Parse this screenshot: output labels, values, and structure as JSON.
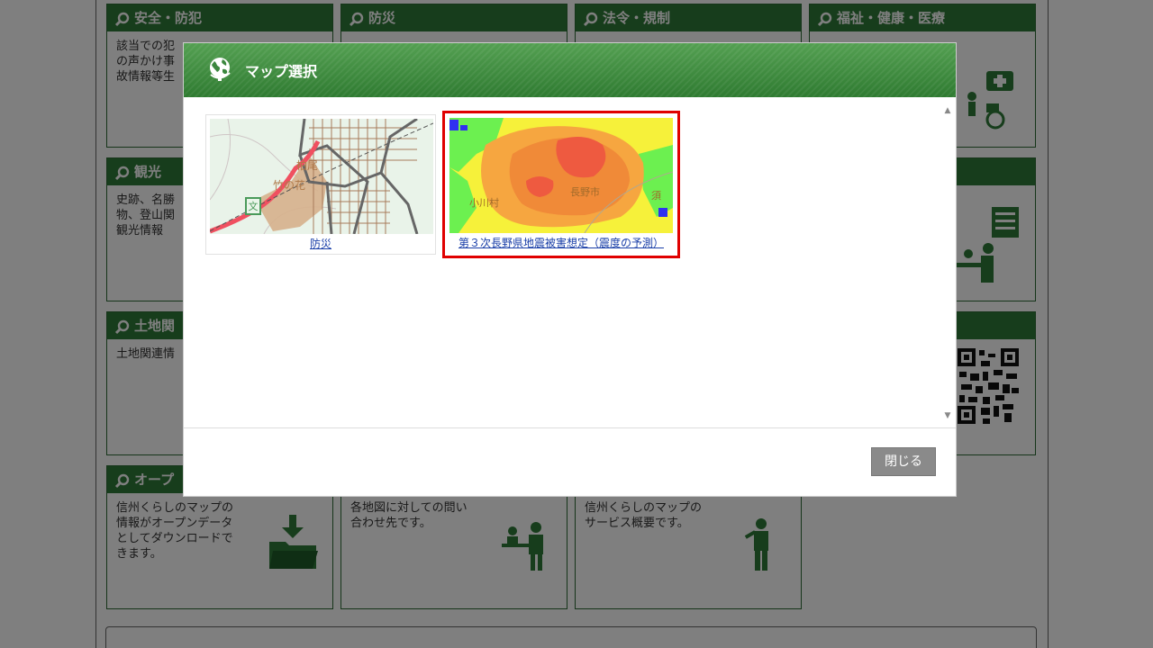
{
  "background": {
    "tiles": [
      {
        "title": "安全・防犯",
        "body": "該当での犯\nの声かけ事\n故情報等生"
      },
      {
        "title": "防災",
        "body": ""
      },
      {
        "title": "法令・規制",
        "body": ""
      },
      {
        "title": "福祉・健康・医療",
        "body": ""
      },
      {
        "title": "観光",
        "body": "史跡、名勝\n物、登山関\n観光情報"
      },
      {
        "title": "土地関",
        "body": "土地関連情"
      },
      {
        "title": "オープ",
        "body": "信州くらしのマップの\n情報がオープンデータ\nとしてダウンロードで\nきます。"
      },
      {
        "title": "",
        "body": "各地図に対しての問い\n合わせ先です。"
      },
      {
        "title": "",
        "body": "信州くらしのマップの\nサービス概要です。"
      }
    ]
  },
  "modal": {
    "title": "マップ選択",
    "maps": [
      {
        "label": "防災",
        "map_texts": [
          "柏尾",
          "竹の花"
        ]
      },
      {
        "label": "第３次長野県地震被害想定（震度の予測）",
        "map_texts": [
          "小川村",
          "長野市",
          "須"
        ]
      }
    ],
    "close_label": "閉じる"
  },
  "colors": {
    "brand_green": "#2f7a38",
    "highlight_red": "#e00000",
    "link_blue": "#1a3fa8"
  }
}
